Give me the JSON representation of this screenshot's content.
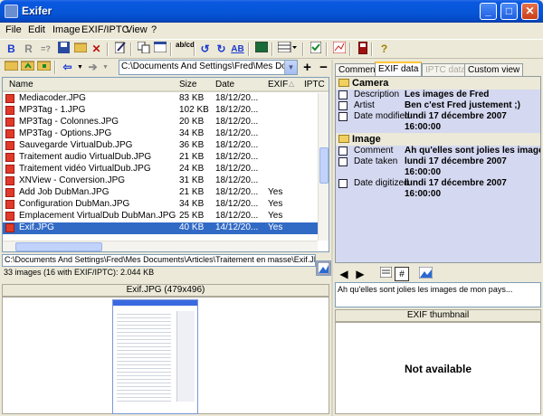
{
  "window": {
    "title": "Exifer",
    "btn_min": "_",
    "btn_max": "□",
    "btn_close": "✕"
  },
  "menu": [
    "File",
    "Edit",
    "Image",
    "EXIF/IPTC",
    "View",
    "?"
  ],
  "toolbar": {
    "bold": "B",
    "r": "R",
    "eq": "=?",
    "rename": "ab/cd",
    "rot_l": "↺",
    "rot_r": "↻",
    "ab": "AB",
    "help": "?"
  },
  "nav": {
    "path": "C:\\Documents And Settings\\Fred\\Mes Docum",
    "plus": "+",
    "minus": "−"
  },
  "filelist": {
    "columns": [
      "Name",
      "Size",
      "Date",
      "EXIF",
      "IPTC"
    ],
    "rows": [
      {
        "name": "Mediacoder.JPG",
        "size": "83 KB",
        "date": "18/12/20...",
        "exif": ""
      },
      {
        "name": "MP3Tag - 1.JPG",
        "size": "102 KB",
        "date": "18/12/20...",
        "exif": ""
      },
      {
        "name": "MP3Tag - Colonnes.JPG",
        "size": "20 KB",
        "date": "18/12/20...",
        "exif": ""
      },
      {
        "name": "MP3Tag - Options.JPG",
        "size": "34 KB",
        "date": "18/12/20...",
        "exif": ""
      },
      {
        "name": "Sauvegarde VirtualDub.JPG",
        "size": "36 KB",
        "date": "18/12/20...",
        "exif": ""
      },
      {
        "name": "Traitement audio VirtualDub.JPG",
        "size": "21 KB",
        "date": "18/12/20...",
        "exif": ""
      },
      {
        "name": "Traitement vidéo VirtualDub.JPG",
        "size": "24 KB",
        "date": "18/12/20...",
        "exif": ""
      },
      {
        "name": "XNView - Conversion.JPG",
        "size": "31 KB",
        "date": "18/12/20...",
        "exif": ""
      },
      {
        "name": "Add Job DubMan.JPG",
        "size": "21 KB",
        "date": "18/12/20...",
        "exif": "Yes"
      },
      {
        "name": "Configuration DubMan.JPG",
        "size": "34 KB",
        "date": "18/12/20...",
        "exif": "Yes"
      },
      {
        "name": "Emplacement VirtualDub DubMan.JPG",
        "size": "25 KB",
        "date": "18/12/20...",
        "exif": "Yes"
      },
      {
        "name": "Exif.JPG",
        "size": "40 KB",
        "date": "14/12/20...",
        "exif": "Yes",
        "selected": true
      }
    ]
  },
  "pathbar": "C:\\Documents And Settings\\Fred\\Mes Documents\\Articles\\Traitement en masse\\Exif.JPG",
  "status": "33 images (16 with EXIF/IPTC): 2.044 KB",
  "preview": {
    "title": "Exif.JPG (479x496)"
  },
  "tabs": [
    {
      "label": "Comment",
      "state": "normal"
    },
    {
      "label": "EXIF data",
      "state": "active"
    },
    {
      "label": "IPTC data",
      "state": "disabled"
    },
    {
      "label": "Custom view",
      "state": "normal"
    }
  ],
  "exif": {
    "camera_title": "Camera",
    "camera": [
      {
        "key": "Description",
        "value": "Les images de Fred"
      },
      {
        "key": "Artist",
        "value": "Ben c'est Fred justement ;)"
      },
      {
        "key": "Date modified",
        "value": "lundi 17 décembre 2007"
      },
      {
        "key": "",
        "value": "16:00:00"
      }
    ],
    "image_title": "Image",
    "image": [
      {
        "key": "Comment",
        "value": "Ah qu'elles sont jolies les image"
      },
      {
        "key": "Date taken",
        "value": "lundi 17 décembre 2007"
      },
      {
        "key": "",
        "value": "16:00:00"
      },
      {
        "key": "Date digitized",
        "value": "lundi 17 décembre 2007"
      },
      {
        "key": "",
        "value": "16:00:00"
      }
    ]
  },
  "comment_text": "Ah qu'elles sont jolies les images de mon pays...",
  "thumbnail": {
    "title": "EXIF thumbnail",
    "empty": "Not available"
  }
}
